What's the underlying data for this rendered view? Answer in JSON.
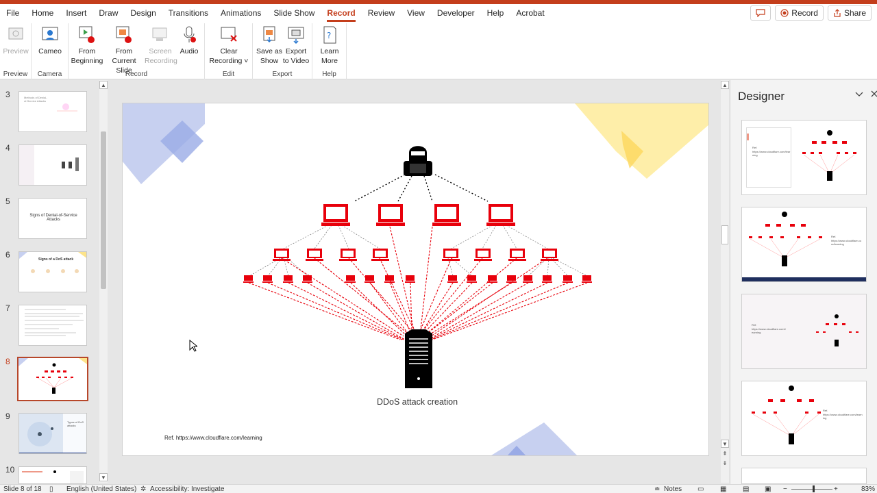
{
  "menu": {
    "tabs": [
      "File",
      "Home",
      "Insert",
      "Draw",
      "Design",
      "Transitions",
      "Animations",
      "Slide Show",
      "Record",
      "Review",
      "View",
      "Developer",
      "Help",
      "Acrobat"
    ],
    "comments_label": "",
    "record_label": "Record",
    "share_label": "Share"
  },
  "ribbon": {
    "preview": {
      "btn": "Preview",
      "group": "Preview"
    },
    "camera": {
      "btn": "Cameo",
      "group": "Camera"
    },
    "record": {
      "from_beginning_1": "From",
      "from_beginning_2": "Beginning",
      "from_current_1": "From",
      "from_current_2": "Current Slide",
      "screen_1": "Screen",
      "screen_2": "Recording",
      "audio": "Audio",
      "group": "Record"
    },
    "edit": {
      "clear_1": "Clear",
      "clear_2": "Recording ˅",
      "group": "Edit"
    },
    "export": {
      "save_1": "Save as",
      "save_2": "Show",
      "export_1": "Export",
      "export_2": "to Video",
      "group": "Export"
    },
    "help": {
      "learn_1": "Learn",
      "learn_2": "More",
      "group": "Help"
    }
  },
  "slides": [
    {
      "num": "3",
      "title": "Methods of Denial-of-Service Attacks"
    },
    {
      "num": "4",
      "title": ""
    },
    {
      "num": "5",
      "title": "Signs of Denial-of-Service Attacks"
    },
    {
      "num": "6",
      "title": "Signs of a DoS attack"
    },
    {
      "num": "7",
      "title": ""
    },
    {
      "num": "8",
      "title": ""
    },
    {
      "num": "9",
      "title": "Types of DoS attacks"
    },
    {
      "num": "10",
      "title": ""
    }
  ],
  "slide": {
    "caption": "DDoS attack creation",
    "reference": "Ref.  https://www.cloudflare.com/learning"
  },
  "designer": {
    "title": "Designer",
    "ref_text": "Ref.",
    "url_text": "https://www.cloudflare.com/learning"
  },
  "status": {
    "slide_of": "Slide 8 of 18",
    "language": "English (United States)",
    "accessibility": "Accessibility: Investigate",
    "notes": "Notes",
    "zoom": "83%"
  },
  "colors": {
    "accent": "#c43e1c",
    "laptop": "#e8000b",
    "slide_blue": "#8fa3e0",
    "slide_yellow": "#fde48b"
  }
}
